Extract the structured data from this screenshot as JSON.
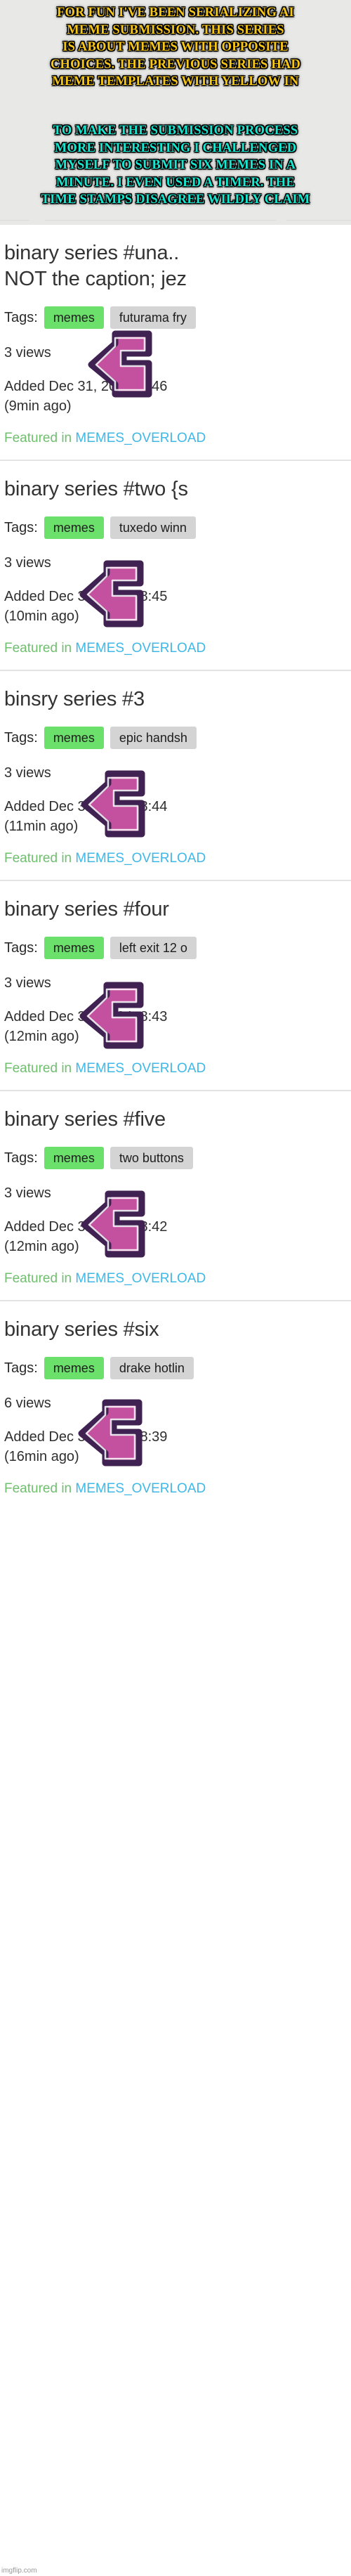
{
  "caption": {
    "top_color": "#f5c518",
    "bottom_color": "#17e6d0",
    "top_lines": [
      "FOR FUN I'VE BEEN SERIALIZING AI",
      "MEME SUBMISSION. THIS SERIES",
      "IS ABOUT MEMES WITH OPPOSITE",
      "CHOICES. THE PREVIOUS SERIES HAD",
      "MEME TEMPLATES WITH YELLOW IN"
    ],
    "bottom_lines": [
      "TO MAKE THE SUBMISSION PROCESS",
      "MORE INTERESTING I CHALLENGED",
      "MYSELF TO SUBMIT SIX MEMES IN A",
      "MINUTE. I EVEN USED A TIMER. THE",
      "TIME STAMPS DISAGREE WILDLY CLAIM"
    ]
  },
  "labels": {
    "tags": "Tags:",
    "featured_prefix": "Featured in ",
    "stream": "MEMES_OVERLOAD"
  },
  "colors": {
    "tag_primary": "#6be06b",
    "tag_secondary": "#d4d4d4",
    "featured_text": "#6fbf6f",
    "stream_link": "#3fb8e8",
    "cursor_fill": "#c4519f",
    "cursor_outline": "#3f2252",
    "title_text": "#333333"
  },
  "entries": [
    {
      "title": "binary series #una..",
      "title2": "NOT the caption; jez",
      "tags": [
        "memes",
        "futurama fry"
      ],
      "views": "3 views",
      "added": "Added Dec 31, 2024, 8:46",
      "ago": "(9min ago)"
    },
    {
      "title": "binary series #two {s",
      "title2": "",
      "tags": [
        "memes",
        "tuxedo winn"
      ],
      "views": "3 views",
      "added": "Added Dec 31, 2024, 8:45",
      "ago": "(10min ago)"
    },
    {
      "title": "binsry series #3",
      "title2": "",
      "tags": [
        "memes",
        "epic handsh"
      ],
      "views": "3 views",
      "added": "Added Dec 31, 2024, 8:44",
      "ago": "(11min ago)"
    },
    {
      "title": "binary series #four",
      "title2": "",
      "tags": [
        "memes",
        "left exit 12 o"
      ],
      "views": "3 views",
      "added": "Added Dec 31, 2024, 8:43",
      "ago": "(12min ago)"
    },
    {
      "title": "binary series #five",
      "title2": "",
      "tags": [
        "memes",
        "two buttons"
      ],
      "views": "3 views",
      "added": "Added Dec 31, 2024, 8:42",
      "ago": "(12min ago)"
    },
    {
      "title": "binary series #six",
      "title2": "",
      "tags": [
        "memes",
        "drake hotlin"
      ],
      "views": "6 views",
      "added": "Added Dec 31, 2024, 8:39",
      "ago": "(16min ago)"
    }
  ],
  "watermark": "imgflip.com"
}
